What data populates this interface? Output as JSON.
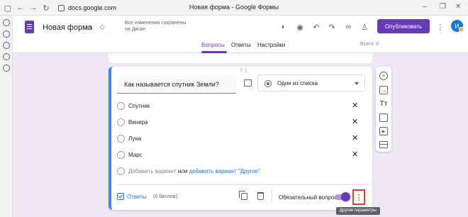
{
  "browser": {
    "url": "docs.google.com",
    "window_title": "Новая форма - Google Формы",
    "minimize_symbol": "–",
    "restore_symbol": "❐",
    "close_symbol": "✕"
  },
  "header": {
    "doc_title": "Новая форма",
    "save_status": "Все изменения сохранены на Диске",
    "publish_label": "Опубликовать",
    "avatar_letter": "И",
    "tabs": [
      {
        "label": "Вопросы",
        "active": true
      },
      {
        "label": "Ответы",
        "active": false
      },
      {
        "label": "Настройки",
        "active": false
      }
    ],
    "total_points": "Всего: 0"
  },
  "question": {
    "text": "Как называется спутник Земли?",
    "type_label": "Один из списка",
    "options": [
      {
        "label": "Спутник"
      },
      {
        "label": "Венера"
      },
      {
        "label": "Луна"
      },
      {
        "label": "Марс"
      }
    ],
    "add_option": "Добавить вариант",
    "or_text": "или",
    "add_other": "добавить вариант \"Другое\"",
    "answers_label": "Ответы",
    "points": "(0 баллов)",
    "required_label": "Обязательный вопрос",
    "required_on": true,
    "more_symbol": "⋮",
    "remove_symbol": "✕"
  },
  "tooltip": {
    "text": "Другие параметры"
  },
  "colors": {
    "brand": "#673ab7",
    "background": "#ede7f6",
    "active_border": "#4285f4",
    "highlight_box": "#e53935"
  },
  "icons": {
    "back": "arrow-left-icon",
    "forward": "arrow-right-icon",
    "reload": "reload-icon",
    "palette": "palette-icon",
    "preview": "eye-icon",
    "undo": "undo-icon",
    "redo": "redo-icon",
    "link": "link-icon",
    "add_collaborator": "person-add-icon",
    "menu": "more-vert-icon"
  }
}
